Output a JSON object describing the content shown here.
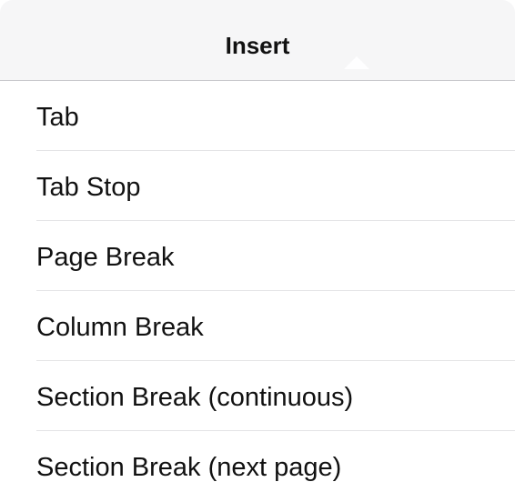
{
  "header": {
    "title": "Insert"
  },
  "menu": {
    "items": [
      {
        "label": "Tab"
      },
      {
        "label": "Tab Stop"
      },
      {
        "label": "Page Break"
      },
      {
        "label": "Column Break"
      },
      {
        "label": "Section Break (continuous)"
      },
      {
        "label": "Section Break (next page)"
      }
    ]
  }
}
